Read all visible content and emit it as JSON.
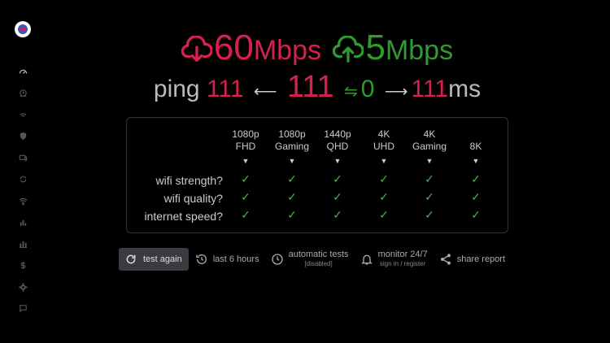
{
  "sidebar": {
    "items": [
      {
        "icon": "speedometer-icon",
        "active": true
      },
      {
        "icon": "history-icon"
      },
      {
        "icon": "signal-icon"
      },
      {
        "icon": "shield-icon"
      },
      {
        "icon": "devices-icon"
      },
      {
        "icon": "sync-icon"
      },
      {
        "icon": "wifi-icon"
      },
      {
        "icon": "bar-chart-icon"
      },
      {
        "icon": "stacked-chart-icon"
      },
      {
        "icon": "dollar-icon"
      },
      {
        "icon": "settings-icon"
      },
      {
        "icon": "chat-icon"
      }
    ]
  },
  "speed": {
    "download": {
      "value": "60",
      "unit": "Mbps",
      "icon": "cloud-download-icon"
    },
    "upload": {
      "value": "5",
      "unit": "Mbps",
      "icon": "cloud-upload-icon"
    }
  },
  "ping": {
    "label": "ping",
    "left": "111",
    "arrow_left": "⟵",
    "center": "111",
    "arrow_swap": "⇋",
    "jitter": "0",
    "arrow_right": "⟶",
    "right": "111",
    "unit": "ms"
  },
  "quality": {
    "columns": [
      {
        "line1": "1080p",
        "line2": "FHD"
      },
      {
        "line1": "1080p",
        "line2": "Gaming"
      },
      {
        "line1": "1440p",
        "line2": "QHD"
      },
      {
        "line1": "4K",
        "line2": "UHD"
      },
      {
        "line1": "4K",
        "line2": "Gaming"
      },
      {
        "line1": "",
        "line2": "8K"
      }
    ],
    "rows": [
      "wifi strength?",
      "wifi quality?",
      "internet speed?"
    ],
    "check_glyph": "✓",
    "indicator": "▼"
  },
  "actions": {
    "test_again": "test again",
    "last_hours": "last 6 hours",
    "automatic_tests": "automatic tests",
    "automatic_status": "[disabled]",
    "monitor": "monitor 24/7",
    "monitor_sub": "sign in / register",
    "share": "share report"
  },
  "colors": {
    "download": "#d8204f",
    "upload": "#2e9a2f",
    "check": "#4bb04a",
    "background": "#000000"
  }
}
